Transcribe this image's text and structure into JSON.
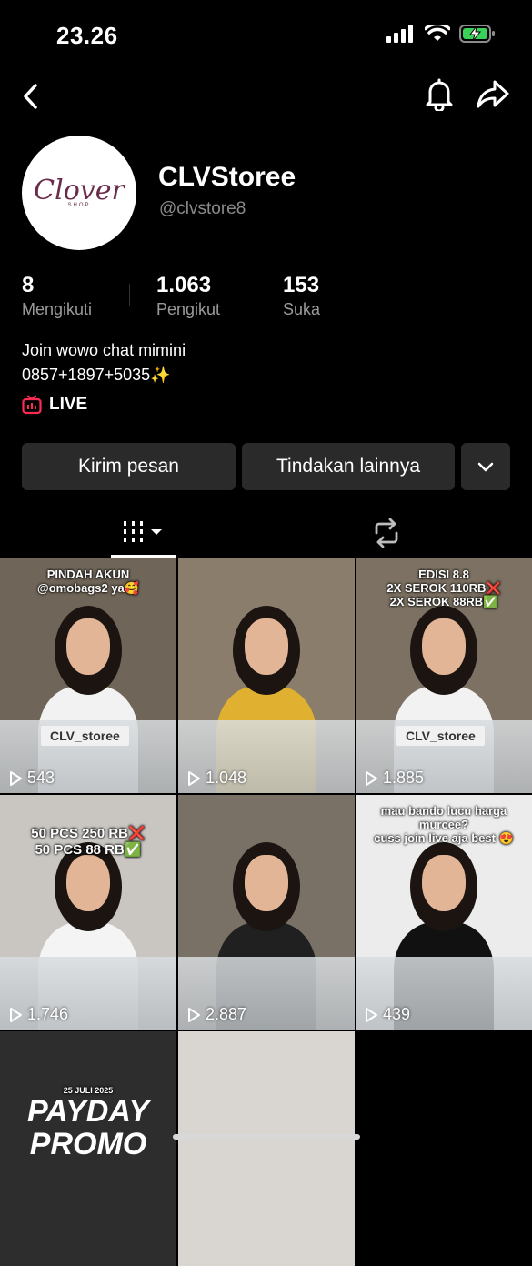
{
  "status": {
    "time": "23.26"
  },
  "profile": {
    "logo_text": "Clover",
    "logo_sub": "SHOP",
    "display_name": "CLVStoree",
    "username": "@clvstore8",
    "bio": "Join wowo chat mimini\n0857+1897+5035✨",
    "live_label": "LIVE"
  },
  "stats": [
    {
      "value": "8",
      "label": "Mengikuti"
    },
    {
      "value": "1.063",
      "label": "Pengikut"
    },
    {
      "value": "153",
      "label": "Suka"
    }
  ],
  "actions": {
    "message_label": "Kirim pesan",
    "more_label": "Tindakan lainnya"
  },
  "videos": [
    {
      "views": "543",
      "caption": "PINDAH AKUN\n@omobags2 ya🥰",
      "sign": "CLV_storee",
      "bg": "#6f6558",
      "shirt": "#f2f2f2"
    },
    {
      "views": "1.048",
      "caption": "",
      "sign": "",
      "bg": "#8a7d6c",
      "shirt": "#e0b030"
    },
    {
      "views": "1.885",
      "caption": "EDISI 8.8\n2X SEROK 110RB❌\n2X SEROK 88RB✅",
      "sign": "CLV_storee",
      "bg": "#7c7162",
      "shirt": "#f2f2f2"
    },
    {
      "views": "1.746",
      "caption": "50 PCS 250 RB❌\n50 PCS 88 RB✅",
      "sign": "",
      "bg": "#c9c6c2",
      "shirt": "#f4f4f4"
    },
    {
      "views": "2.887",
      "caption": "",
      "sign": "",
      "bg": "#7a7166",
      "shirt": "#202020"
    },
    {
      "views": "439",
      "caption": "mau bando lucu harga\nmurcee?\ncuss join live aja best 😍",
      "sign": "",
      "bg": "#ececec",
      "shirt": "#111111"
    },
    {
      "views": "",
      "caption": "25 JULI 2025",
      "sign": "",
      "bg": "#2d2d2d",
      "shirt": "",
      "promo": "PAYDAY\nPROMO"
    },
    {
      "views": "",
      "caption": "",
      "sign": "",
      "bg": "#d9d6d2",
      "shirt": ""
    }
  ]
}
